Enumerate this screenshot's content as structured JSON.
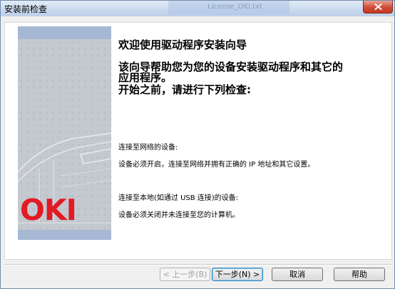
{
  "window": {
    "title": "安装前检查",
    "background_window_title": "License_OKI.txt"
  },
  "colors": {
    "brand_red": "#e31a23",
    "banner_gray": "#c3c9cf",
    "banner_blue": "#a6b8d4"
  },
  "icons": {
    "close": "close-icon",
    "printer": "printer-illustration"
  },
  "banner": {
    "logo": "OKI"
  },
  "content": {
    "heading": "欢迎使用驱动程序安装向导",
    "intro_line1": "该向导帮助您为您的设备安装驱动程序和其它的",
    "intro_line2": "应用程序。",
    "intro_line3": "开始之前，请进行下列检查:",
    "network_title": "连接至网络的设备:",
    "network_desc": "设备必须开启，连接至网络并拥有正确的 IP 地址和其它设置。",
    "local_title": "连接至本地(如通过 USB 连接)的设备:",
    "local_desc": "设备必须关闭并未连接至您的计算机。"
  },
  "buttons": {
    "back": "< 上一步(B)",
    "next": "下一步(N) >",
    "cancel": "取消",
    "help": "帮助"
  }
}
